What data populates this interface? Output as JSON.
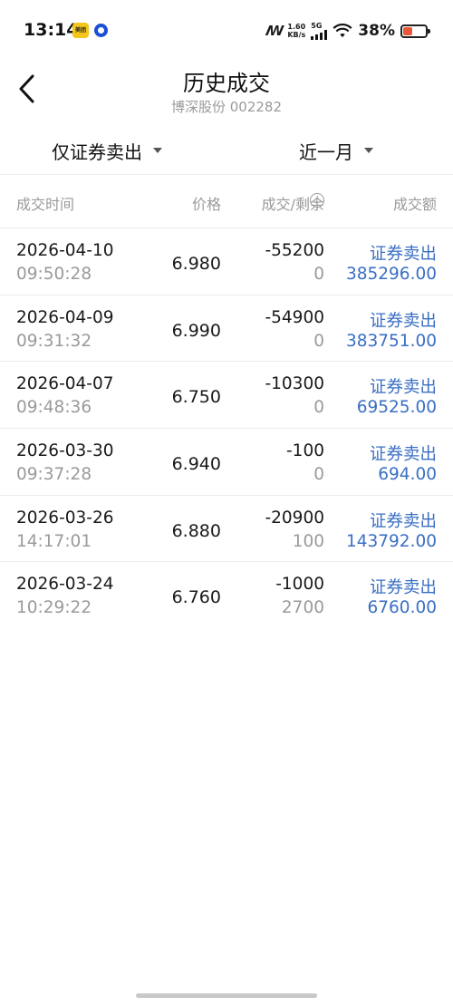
{
  "status_bar": {
    "time": "13:14",
    "app_icon_1": "美团",
    "network_speed_value": "1.60",
    "network_speed_unit": "KB/s",
    "network_type": "5G",
    "battery_percent": "38%",
    "battery_level": 0.38
  },
  "header": {
    "title": "历史成交",
    "subtitle": "博深股份 002282"
  },
  "filters": {
    "type_label": "仅证券卖出",
    "period_label": "近一月"
  },
  "table": {
    "columns": {
      "time": "成交时间",
      "price": "价格",
      "qty": "成交/剩余",
      "amount": "成交额"
    },
    "rows": [
      {
        "date": "2026-04-10",
        "time": "09:50:28",
        "price": "6.980",
        "qty": "-55200",
        "remain": "0",
        "type": "证券卖出",
        "amount": "385296.00"
      },
      {
        "date": "2026-04-09",
        "time": "09:31:32",
        "price": "6.990",
        "qty": "-54900",
        "remain": "0",
        "type": "证券卖出",
        "amount": "383751.00"
      },
      {
        "date": "2026-04-07",
        "time": "09:48:36",
        "price": "6.750",
        "qty": "-10300",
        "remain": "0",
        "type": "证券卖出",
        "amount": "69525.00"
      },
      {
        "date": "2026-03-30",
        "time": "09:37:28",
        "price": "6.940",
        "qty": "-100",
        "remain": "0",
        "type": "证券卖出",
        "amount": "694.00"
      },
      {
        "date": "2026-03-26",
        "time": "14:17:01",
        "price": "6.880",
        "qty": "-20900",
        "remain": "100",
        "type": "证券卖出",
        "amount": "143792.00"
      },
      {
        "date": "2026-03-24",
        "time": "10:29:22",
        "price": "6.760",
        "qty": "-1000",
        "remain": "2700",
        "type": "证券卖出",
        "amount": "6760.00"
      }
    ]
  },
  "colors": {
    "accent": "#3a6fc4",
    "muted": "#9a9a9a",
    "battery_low": "#e8573a"
  }
}
